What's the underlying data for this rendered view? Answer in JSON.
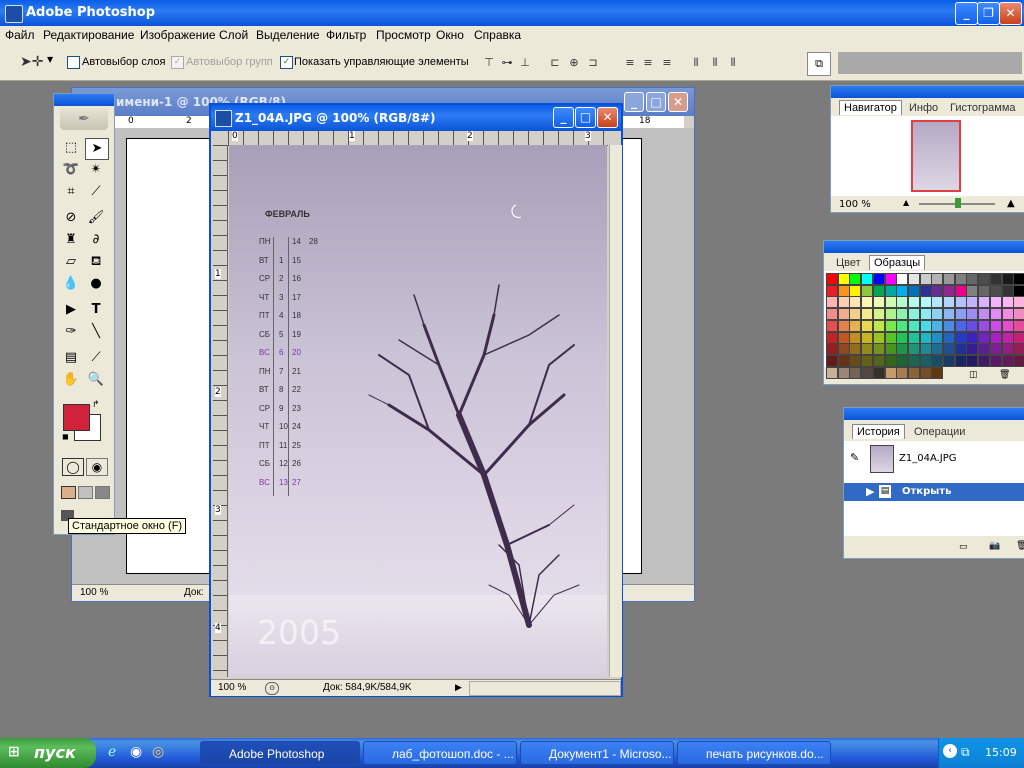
{
  "app": {
    "title": "Adobe Photoshop"
  },
  "menu": [
    "Файл",
    "Редактирование",
    "Изображение",
    "Слой",
    "Выделение",
    "Фильтр",
    "Просмотр",
    "Окно",
    "Справка"
  ],
  "options": {
    "auto_select_layer": "Автовыбор слоя",
    "auto_select_groups": "Автовыбор групп",
    "show_controls": "Показать управляющие элементы"
  },
  "back_doc": {
    "title": "имени-1 @ 100% (RGB/8)",
    "zoom": "100 %",
    "status": "Док:",
    "ruler_top": [
      "0",
      "2",
      "18"
    ],
    "ruler_left": [
      "1",
      "2"
    ]
  },
  "doc": {
    "title": "Z1_04A.JPG @ 100% (RGB/8#)",
    "zoom": "100 %",
    "status": "Док: 584,9K/584,9K",
    "ruler_top": [
      "0",
      "1",
      "2",
      "3"
    ],
    "ruler_left": [
      "1",
      "2",
      "3",
      "4"
    ]
  },
  "calendar": {
    "month": "ФЕВРАЛЬ",
    "year": "2005",
    "rows": [
      [
        "ПН",
        "",
        "14",
        "28"
      ],
      [
        "ВТ",
        "1",
        "15",
        ""
      ],
      [
        "СР",
        "2",
        "16",
        ""
      ],
      [
        "ЧТ",
        "3",
        "17",
        ""
      ],
      [
        "ПТ",
        "4",
        "18",
        ""
      ],
      [
        "СБ",
        "5",
        "19",
        ""
      ],
      [
        "ВС",
        "6",
        "20",
        ""
      ],
      [
        "ПН",
        "7",
        "21",
        ""
      ],
      [
        "ВТ",
        "8",
        "22",
        ""
      ],
      [
        "СР",
        "9",
        "23",
        ""
      ],
      [
        "ЧТ",
        "10",
        "24",
        ""
      ],
      [
        "ПТ",
        "11",
        "25",
        ""
      ],
      [
        "СБ",
        "12",
        "26",
        ""
      ],
      [
        "ВС",
        "13",
        "27",
        ""
      ]
    ]
  },
  "tooltip": "Стандартное окно (F)",
  "navigator": {
    "tabs": [
      "Навигатор",
      "Инфо",
      "Гистограмма"
    ],
    "zoom": "100 %"
  },
  "swatches": {
    "tabs": [
      "Цвет",
      "Образцы"
    ]
  },
  "history": {
    "tabs": [
      "История",
      "Операции"
    ],
    "snapshot": "Z1_04A.JPG",
    "step": "Открыть"
  },
  "taskbar": {
    "start": "пуск",
    "items": [
      "Adobe Photoshop",
      "лаб_фотошоп.doc - ...",
      "Документ1 - Microso...",
      "печать рисунков.do..."
    ],
    "clock": "15:09"
  },
  "colors": {
    "foreground": "#d0223a",
    "background": "#ffffff",
    "accent": "#0a5ee6"
  }
}
